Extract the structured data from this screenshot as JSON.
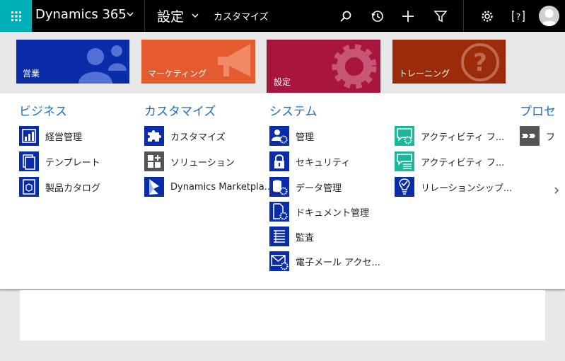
{
  "topbar": {
    "app_name": "Dynamics 365",
    "breadcrumb_area": "設定",
    "breadcrumb_page": "カスタマイズ"
  },
  "tiles": [
    {
      "label": "営業",
      "color": "#0b2ca8"
    },
    {
      "label": "マーケティング",
      "color": "#e35b2e"
    },
    {
      "label": "設定",
      "color": "#a8163d"
    },
    {
      "label": "トレーニング",
      "color": "#9b2b0a"
    }
  ],
  "columns": {
    "business": {
      "title": "ビジネス",
      "items": [
        {
          "label": "経営管理",
          "icon": "chart-report-icon"
        },
        {
          "label": "テンプレート",
          "icon": "templates-icon"
        },
        {
          "label": "製品カタログ",
          "icon": "product-catalog-icon"
        }
      ]
    },
    "customize": {
      "title": "カスタマイズ",
      "items": [
        {
          "label": "カスタマイズ",
          "icon": "puzzle-icon"
        },
        {
          "label": "ソリューション",
          "icon": "solutions-icon"
        },
        {
          "label": "Dynamics Marketpla...",
          "icon": "dynamics-marketplace-icon"
        }
      ]
    },
    "system": {
      "title": "システム",
      "items": [
        {
          "label": "管理",
          "icon": "administration-icon"
        },
        {
          "label": "セキュリティ",
          "icon": "lock-icon"
        },
        {
          "label": "データ管理",
          "icon": "data-management-icon"
        },
        {
          "label": "ドキュメント管理",
          "icon": "document-management-icon"
        },
        {
          "label": "監査",
          "icon": "auditing-icon"
        },
        {
          "label": "電子メール アクセ...",
          "icon": "email-config-icon"
        }
      ]
    },
    "system2": {
      "items": [
        {
          "label": "アクティビティ フ...",
          "icon": "activity-feeds-config-icon"
        },
        {
          "label": "アクティビティ フ...",
          "icon": "activity-feeds-rules-icon"
        },
        {
          "label": "リレーションシップ...",
          "icon": "relationship-insights-icon"
        }
      ]
    },
    "process": {
      "title": "プロセ",
      "items": [
        {
          "label": "フ",
          "icon": "process-center-icon"
        }
      ]
    }
  },
  "colors": {
    "waffle": "#00b0b9",
    "heading": "#1e6fbf",
    "icon_blue": "#0b2ca8",
    "icon_teal": "#1bb79b",
    "icon_gray": "#555555"
  }
}
